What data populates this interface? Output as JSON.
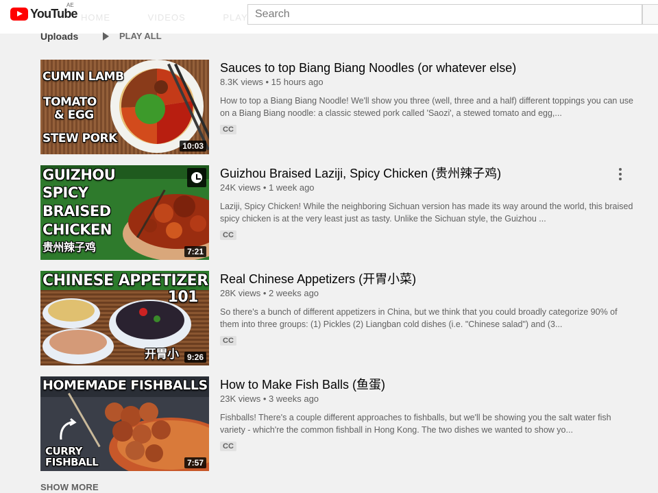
{
  "header": {
    "logo_text": "YouTube",
    "region": "AE",
    "ghost_tabs": [
      "HOME",
      "VIDEOS",
      "PLAYLISTS"
    ],
    "search_placeholder": "Search"
  },
  "uploads": {
    "title": "Uploads",
    "play_all": "PLAY ALL"
  },
  "videos": [
    {
      "title": "Sauces to top Biang Biang Noodles (or whatever else)",
      "views": "8.3K views",
      "age": "15 hours ago",
      "description": "How to top a Biang Biang Noodle! We'll show you three (well, three and a half) different toppings you can use on a Biang Biang noodle: a classic stewed pork called 'Saozi', a stewed tomato and egg,...",
      "badge": "CC",
      "duration": "10:03",
      "thumb_lines": [
        "CUMIN LAMB",
        "TOMATO",
        "& EGG",
        "STEW PORK"
      ]
    },
    {
      "title": "Guizhou Braised Laziji, Spicy Chicken (贵州辣子鸡)",
      "views": "24K views",
      "age": "1 week ago",
      "description": "Laziji, Spicy Chicken! While the neighboring Sichuan version has made its way around the world, this braised spicy chicken is at the very least just as tasty. Unlike the Sichuan style, the Guizhou ...",
      "badge": "CC",
      "duration": "7:21",
      "thumb_lines": [
        "GUIZHOU",
        "SPICY",
        "BRAISED",
        "CHICKEN",
        "贵州辣子鸡"
      ]
    },
    {
      "title": "Real Chinese Appetizers (开胃小菜)",
      "views": "28K views",
      "age": "2 weeks ago",
      "description": "So there's a bunch of different appetizers in China, but we think that you could broadly categorize 90% of them into three groups: (1) Pickles (2) Liangban cold dishes (i.e. \"Chinese salad\") and (3...",
      "badge": "CC",
      "duration": "9:26",
      "thumb_lines": [
        "CHINESE APPETIZER",
        "101",
        "开胃小"
      ]
    },
    {
      "title": "How to Make Fish Balls (鱼蛋)",
      "views": "23K views",
      "age": "3 weeks ago",
      "description": "Fishballs! There's a couple different approaches to fishballs, but we'll be showing you the salt water fish variety - which're the common fishball in Hong Kong. The two dishes we wanted to show yo...",
      "badge": "CC",
      "duration": "7:57",
      "thumb_lines": [
        "HOMEMADE FISHBALLS",
        "CURRY",
        "FISHBALL"
      ]
    }
  ],
  "show_more": "SHOW MORE",
  "colors": {
    "brand_red": "#ff0000",
    "background": "#f1f1f1",
    "meta_text": "#606060"
  }
}
